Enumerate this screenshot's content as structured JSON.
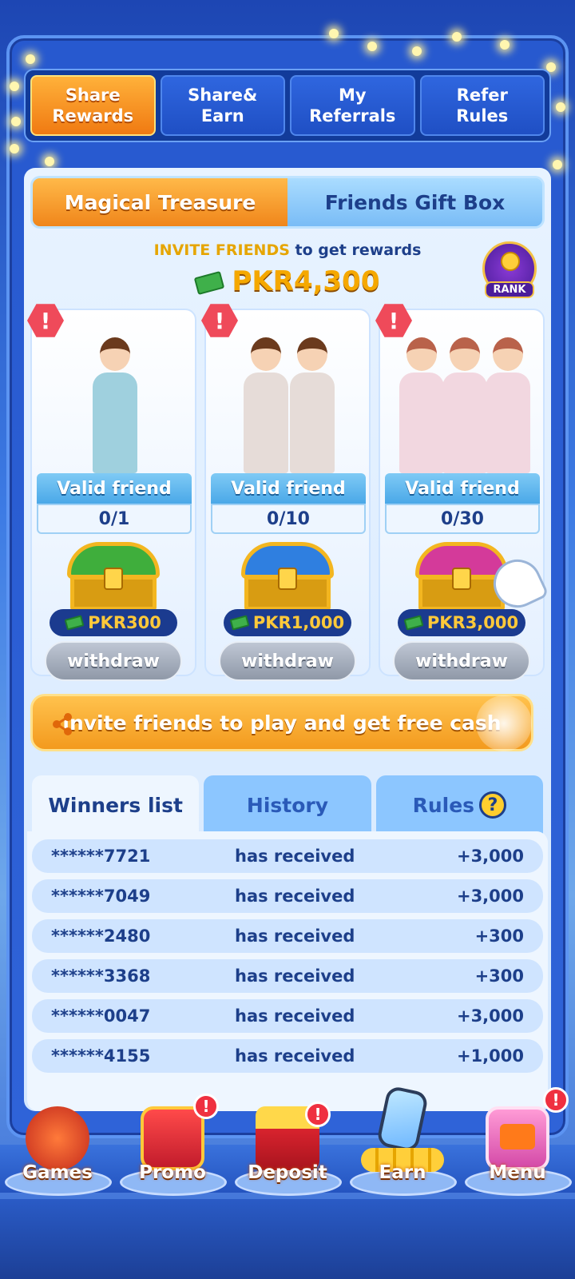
{
  "top_tabs": [
    {
      "label": "Share\nRewards",
      "active": true
    },
    {
      "label": "Share&\nEarn",
      "active": false
    },
    {
      "label": "My\nReferrals",
      "active": false
    },
    {
      "label": "Refer\nRules",
      "active": false
    }
  ],
  "segment": {
    "left": "Magical Treasure",
    "right": "Friends Gift Box"
  },
  "invite": {
    "highlight": "INVITE FRIENDS",
    "rest": " to get  rewards",
    "total": "PKR4,300",
    "rank_label": "RANK"
  },
  "cards": [
    {
      "alert": "!",
      "label": "Valid friend",
      "count": "0/1",
      "reward": "PKR300",
      "button": "withdraw",
      "chest_color": "#3fae3c"
    },
    {
      "alert": "!",
      "label": "Valid friend",
      "count": "0/10",
      "reward": "PKR1,000",
      "button": "withdraw",
      "chest_color": "#2f7fe0"
    },
    {
      "alert": "!",
      "label": "Valid friend",
      "count": "0/30",
      "reward": "PKR3,000",
      "button": "withdraw",
      "chest_color": "#d43a9a"
    }
  ],
  "invite_button": "invite friends to play and get free cash",
  "list_tabs": {
    "winners": "Winners list",
    "history": "History",
    "rules": "Rules",
    "rules_icon": "?"
  },
  "winners": [
    {
      "id": "******7721",
      "text": "has received",
      "amount": "+3,000"
    },
    {
      "id": "******7049",
      "text": "has received",
      "amount": "+3,000"
    },
    {
      "id": "******2480",
      "text": "has received",
      "amount": "+300"
    },
    {
      "id": "******3368",
      "text": "has received",
      "amount": "+300"
    },
    {
      "id": "******0047",
      "text": "has received",
      "amount": "+3,000"
    },
    {
      "id": "******4155",
      "text": "has received",
      "amount": "+1,000"
    }
  ],
  "bottom_nav": [
    {
      "label": "Games",
      "icon": "games-icon",
      "badge": ""
    },
    {
      "label": "Promo",
      "icon": "gift-icon",
      "badge": "!"
    },
    {
      "label": "Deposit",
      "icon": "treasure-chest-icon",
      "badge": "!"
    },
    {
      "label": "Earn",
      "icon": "phone-coins-icon",
      "badge": ""
    },
    {
      "label": "Menu",
      "icon": "menu-tv-icon",
      "badge": "!"
    }
  ],
  "colors": {
    "accent_orange": "#f39a1e",
    "navy": "#1d3f8a",
    "gold": "#f5a800",
    "alert_red": "#ef4a5a"
  }
}
